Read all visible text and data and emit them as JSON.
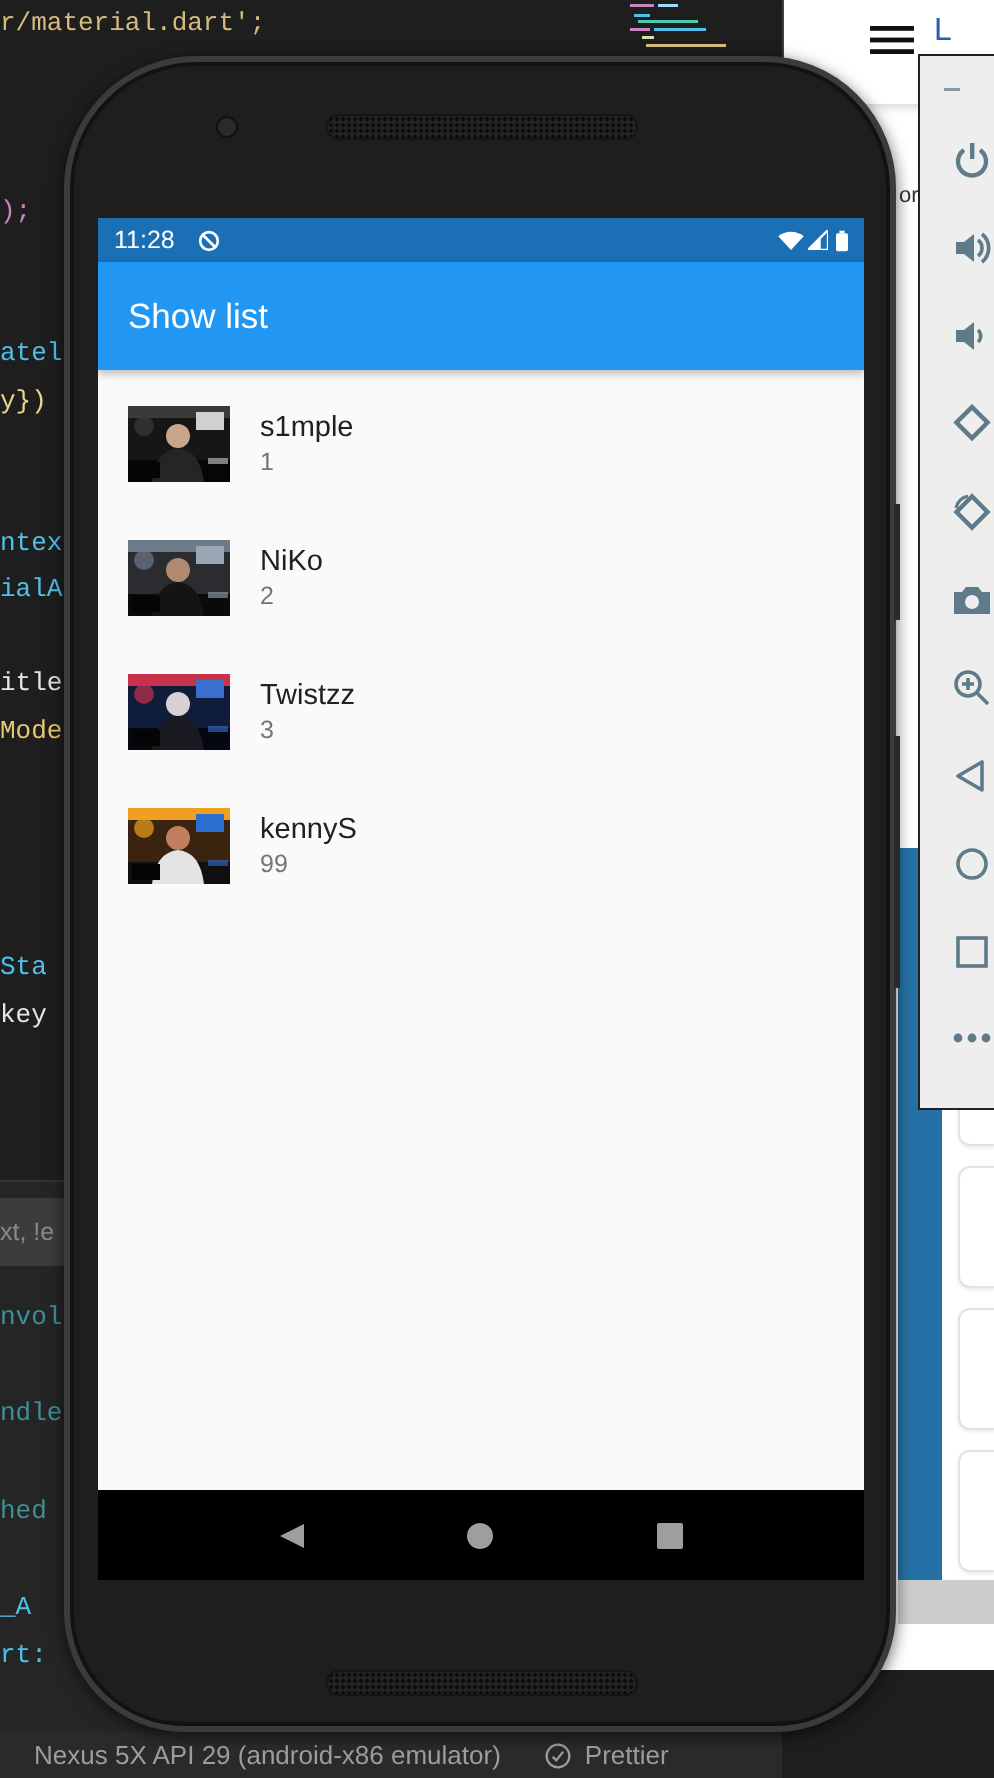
{
  "editor": {
    "code_lines": [
      {
        "text": "r/material.dart';",
        "color": "#d7ba7d"
      },
      {
        "text": ");",
        "color": "#c586c0"
      },
      {
        "text": "atel",
        "color": "#4fc1e9"
      },
      {
        "text": "y})",
        "color": "#e8d98a"
      },
      {
        "text": "ntex",
        "color": "#4fc1e9"
      },
      {
        "text": "ialA",
        "color": "#4fc1e9"
      },
      {
        "text": "itle",
        "color": "#e6e6e6"
      },
      {
        "text": "Mode",
        "color": "#e8c872"
      },
      {
        "text": "Sta",
        "color": "#4fc1e9"
      },
      {
        "text": "key",
        "color": "#e6e6e6"
      }
    ],
    "panel": {
      "search": {
        "placeholder": "xt, !e"
      },
      "lines": [
        {
          "text": "nvol",
          "color": "#3f8f99"
        },
        {
          "text": "ndle",
          "color": "#3f8f99"
        },
        {
          "text": "hed",
          "color": "#3f8f99"
        },
        {
          "text": "_A",
          "color": "#4fc1e9"
        },
        {
          "text": "rt:",
          "color": "#4fc1e9"
        }
      ]
    },
    "status_bar": {
      "device": "Nexus 5X API 29 (android-x86 emulator)",
      "formatter": "Prettier"
    }
  },
  "browser": {
    "link": "L",
    "text": "or"
  },
  "phone": {
    "time": "11:28",
    "title": "Show list",
    "players": [
      {
        "name": "s1mple",
        "rank": "1"
      },
      {
        "name": "NiKo",
        "rank": "2"
      },
      {
        "name": "Twistzz",
        "rank": "3"
      },
      {
        "name": "kennyS",
        "rank": "99"
      }
    ]
  }
}
